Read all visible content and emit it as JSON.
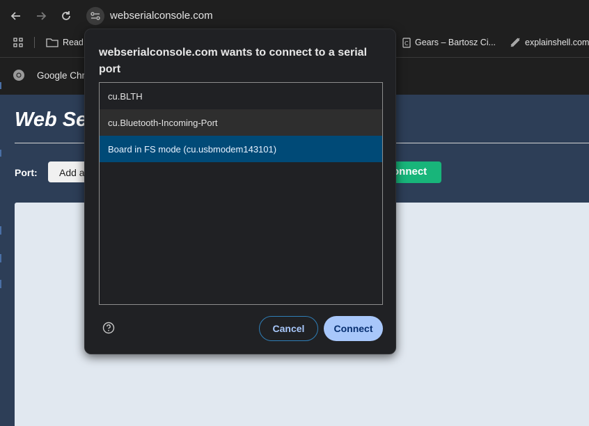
{
  "browser": {
    "url": "webserialconsole.com",
    "bookmarks": [
      "Read",
      "Gears – Bartosz Ci...",
      "explainshell.com"
    ],
    "infobar_text": "Google Chr"
  },
  "page": {
    "title": "Web Se",
    "port_label": "Port:",
    "add_button": "Add a",
    "connect_button": "onnect"
  },
  "dialog": {
    "title": "webserialconsole.com wants to connect to a serial port",
    "ports": [
      "cu.BLTH",
      "cu.Bluetooth-Incoming-Port",
      "Board in FS mode (cu.usbmodem143101)"
    ],
    "selected_index": 2,
    "cancel_label": "Cancel",
    "connect_label": "Connect"
  },
  "colors": {
    "selected_row": "#004a77",
    "connect_button": "#a8c7fa",
    "page_connect_green": "#18b57a"
  }
}
